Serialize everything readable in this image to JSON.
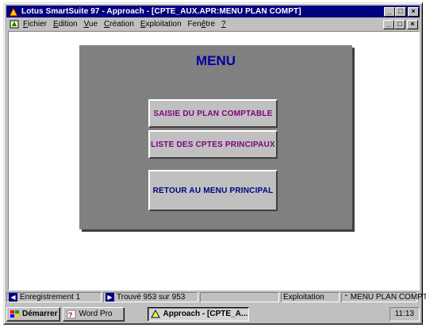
{
  "window": {
    "title": "Lotus SmartSuite 97  - Approach - [CPTE_AUX.APR:MENU PLAN COMPT]",
    "minimize": "_",
    "restore": "□",
    "close": "×"
  },
  "menubar": {
    "items": [
      {
        "ul": "F",
        "rest": "ichier"
      },
      {
        "ul": "E",
        "rest": "dition"
      },
      {
        "ul": "V",
        "rest": "ue"
      },
      {
        "ul": "C",
        "rest": "réation"
      },
      {
        "ul": "E",
        "rest": "xploitation"
      },
      {
        "pre": "Fen",
        "ul": "ê",
        "rest": "tre"
      },
      {
        "ul": "?",
        "rest": ""
      }
    ]
  },
  "panel": {
    "title": "MENU",
    "buttons": [
      "SAISIE DU PLAN COMPTABLE",
      "LISTE DES CPTES PRINCIPAUX",
      "RETOUR AU MENU PRINCIPAL"
    ]
  },
  "status": {
    "record": "Enregistrement 1",
    "found": "Trouvé 953 sur 953",
    "mode": "Exploitation",
    "view": "MENU PLAN COMPT"
  },
  "taskbar": {
    "start": "Démarrer",
    "wordpro": "Word Pro",
    "approach": "Approach - [CPTE_A...",
    "clock": "11:13"
  },
  "colors": {
    "titlebar": "#000080",
    "panel": "#808080",
    "menu_title": "#0000a0",
    "button_text": "#800080"
  }
}
